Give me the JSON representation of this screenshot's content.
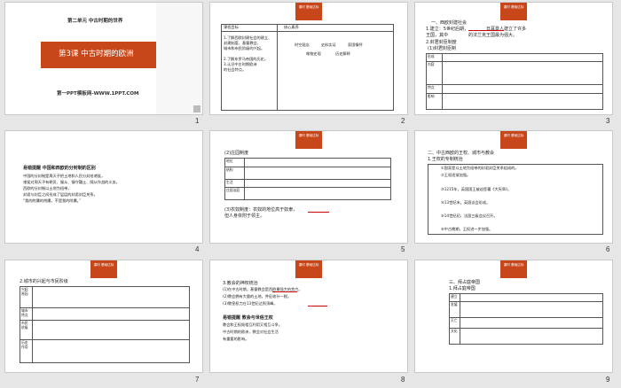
{
  "slides": [
    {
      "num": "1",
      "unit": "第二单元  中古时期的世界",
      "lesson": "第3课   中古时期的欧洲",
      "footer": "第一PPT模板网-WWW.1PPT.COM"
    },
    {
      "num": "2",
      "tag": "课时 基础达标",
      "header_left": "课程目标",
      "header_right": "核心素养",
      "goals": [
        "1.了解西欧封建社会的建立、",
        "封建制度、基督教会、",
        "城市和市民阶级的兴起。",
        "2.了解东罗马帝国的历史。",
        "3.认识中古时期欧洲",
        "的社会特点。"
      ],
      "right_words": [
        "时空观念",
        "史料实证",
        "家国情怀",
        "唯物史观",
        "历史解释"
      ]
    },
    {
      "num": "3",
      "tag": "课时 基础达标",
      "lines": [
        "一、西欧封建社会",
        "1.建立：5世纪后期，",
        "日耳曼人建立了许多",
        "王国，其中",
        "的法兰克王国最为强大。",
        "2.封君封臣制度",
        "(1)封君封臣制"
      ],
      "rows": [
        "形成",
        "内容",
        "特点",
        "影响"
      ]
    },
    {
      "num": "4",
      "title": "易错提醒 中国和西欧的分封制的区别",
      "paras": [
        "中国的分封制是周天子把土地和人民分封给诸侯，",
        "诸侯对周天子有朝贡、服从、镇守疆土、随从作战的义务。",
        "西欧的分封制以土地为纽带，",
        "封君与封臣之间形成了层层的封君封臣关系。",
        "“我的附庸的附庸，不是我的附庸。”"
      ]
    },
    {
      "num": "5",
      "tag": "课时 基础达标",
      "head": "(2)庄园制度",
      "rows": [
        "地位",
        "结构",
        "生活",
        "庄园法庭"
      ],
      "foot": [
        "(3)农奴制度：农奴的地位高于奴隶，",
        "但人身依附于领主。"
      ]
    },
    {
      "num": "6",
      "tag": "课时 基础达标",
      "head": "二、中古西欧的王权、城市与教会",
      "sub": "1.王权的专制统治",
      "items": [
        "①国家是以土地为纽带的封君封臣关系组成的。",
        "②王权逐渐加强。",
        "③1215年，英国国王被迫签署《大宪章》。",
        "④13世纪末，英国议会形成。",
        "⑤14世纪初，法国三级会议召开。",
        "⑥中古晚期，王权进一步加强。"
      ]
    },
    {
      "num": "7",
      "tag": "课时 基础达标",
      "head": "2.城市的兴起与市民阶级",
      "rows": [
        "兴起原因",
        "城市特点",
        "市民阶级",
        "历史作用"
      ]
    },
    {
      "num": "8",
      "tag": "课时 基础达标",
      "head": [
        "3.教会的神权统治",
        "(1)在中古时期，基督教会是西欧最强大的势力。",
        "(2)教会拥有大量的土地，并征收什一税。",
        "(3)教皇权力在13世纪达到顶峰。"
      ],
      "para": [
        "易错提醒 教会与世俗王权",
        "教会和王权既相互利用又相互斗争。",
        "中古时期的欧洲，教会对社会生活",
        "有重要的影响。"
      ]
    },
    {
      "num": "9",
      "tag": "课时 基础达标",
      "head": [
        "三、拜占庭帝国",
        "1.拜占庭帝国"
      ],
      "rows": [
        "建立",
        "发展",
        "灭亡",
        "文化"
      ]
    }
  ]
}
